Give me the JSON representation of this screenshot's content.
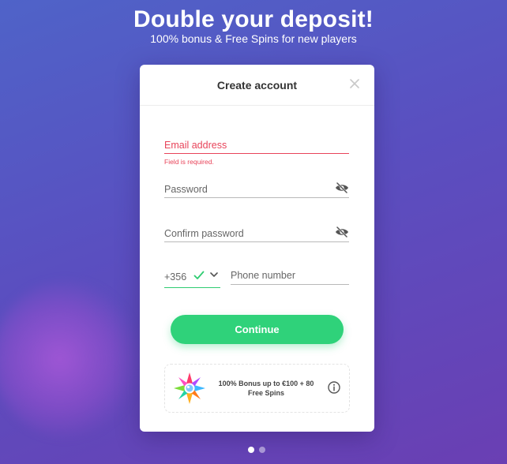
{
  "hero": {
    "title": "Double your deposit!",
    "subtitle": "100% bonus & Free Spins for new players"
  },
  "modal": {
    "title": "Create account",
    "close_icon": "close-icon"
  },
  "form": {
    "email": {
      "label": "Email address",
      "error": "Field is required."
    },
    "password": {
      "label": "Password",
      "icon": "eye-off-icon"
    },
    "confirm_password": {
      "label": "Confirm password",
      "icon": "eye-off-icon"
    },
    "phone": {
      "country_code": "+356",
      "placeholder": "Phone number"
    },
    "continue_label": "Continue"
  },
  "bonus": {
    "text": "100% Bonus up to €100 + 80 Free Spins",
    "icon": "info-icon"
  },
  "colors": {
    "accent": "#2fd27a",
    "error": "#e8445a"
  },
  "pagination": {
    "total": 2,
    "active": 1
  }
}
